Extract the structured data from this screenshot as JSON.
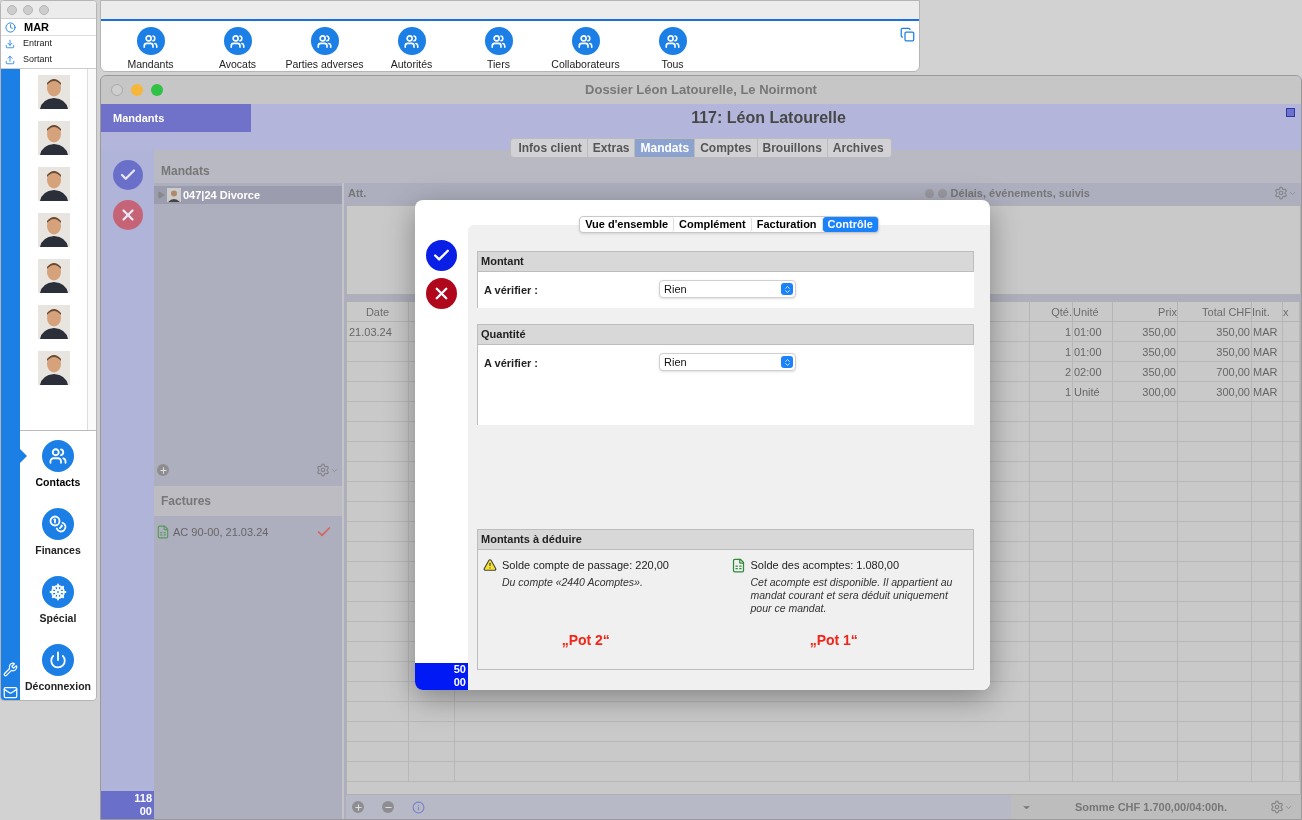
{
  "sidebar_window": {
    "user": "MAR",
    "mail_items": [
      {
        "label": "Entrant",
        "kind": "download"
      },
      {
        "label": "Sortant",
        "kind": "upload"
      }
    ],
    "avatars": [
      {
        "kind": "person"
      },
      {
        "kind": "person"
      },
      {
        "kind": "person"
      },
      {
        "kind": "person"
      },
      {
        "kind": "person"
      },
      {
        "kind": "person"
      },
      {
        "kind": "person"
      }
    ],
    "nav": [
      {
        "label": "Contacts",
        "kind": "contacts",
        "selected": true
      },
      {
        "label": "Finances",
        "kind": "finances",
        "selected": false
      },
      {
        "label": "Spécial",
        "kind": "wheel",
        "selected": false
      },
      {
        "label": "Déconnexion",
        "kind": "power",
        "selected": false
      }
    ]
  },
  "toolbar_window": {
    "buttons": [
      {
        "label": "Mandants"
      },
      {
        "label": "Avocats"
      },
      {
        "label": "Parties adverses"
      },
      {
        "label": "Autorités"
      },
      {
        "label": "Tiers"
      },
      {
        "label": "Collaborateurs"
      },
      {
        "label": "Tous"
      }
    ]
  },
  "main_window": {
    "title": "Dossier Léon Latourelle, Le Noirmont",
    "section": "Mandants",
    "heading": "117: Léon Latourelle",
    "tabs": [
      {
        "label": "Infos client",
        "selected": false
      },
      {
        "label": "Extras",
        "selected": false
      },
      {
        "label": "Mandats",
        "selected": true
      },
      {
        "label": "Comptes",
        "selected": false
      },
      {
        "label": "Brouillons",
        "selected": false
      },
      {
        "label": "Archives",
        "selected": false
      }
    ],
    "counter": [
      "118",
      "00"
    ],
    "mandats": {
      "title": "Mandats",
      "items": [
        {
          "label": "047|24 Divorce",
          "selected": true
        }
      ]
    },
    "factures": {
      "title": "Factures",
      "items": [
        {
          "label": "AC 90-00, 21.03.24",
          "checked": true
        }
      ]
    },
    "att_label": "Att.",
    "events_label": "Délais, événements, suivis",
    "table": {
      "columns_left": [
        "Date"
      ],
      "columns_right": [
        "Qté.",
        "Unité",
        "Prix",
        "Total CHF",
        "Init.",
        "x"
      ],
      "rows": [
        {
          "date": "21.03.24",
          "cells": [
            "1",
            "01:00",
            "350,00",
            "350,00",
            "MAR"
          ]
        },
        {
          "cells": [
            "1",
            "01:00",
            "350,00",
            "350,00",
            "MAR"
          ]
        },
        {
          "cells": [
            "2",
            "02:00",
            "350,00",
            "700,00",
            "MAR"
          ]
        },
        {
          "cells": [
            "1",
            "Unité",
            "300,00",
            "300,00",
            "MAR"
          ]
        }
      ]
    },
    "footer": "Somme CHF 1.700,00/04:00h."
  },
  "dialog": {
    "tabs": [
      {
        "label": "Vue d'ensemble",
        "selected": false
      },
      {
        "label": "Complément",
        "selected": false
      },
      {
        "label": "Facturation",
        "selected": false
      },
      {
        "label": "Contrôle",
        "selected": true
      }
    ],
    "sections": [
      {
        "title": "Montant",
        "label": "A vérifier :",
        "value": "Rien",
        "kind": "short"
      },
      {
        "title": "Quantité",
        "label": "A vérifier :",
        "value": "Rien",
        "kind": "tall"
      }
    ],
    "deductions": {
      "title": "Montants à déduire",
      "items": [
        {
          "kind": "warning",
          "title": "Solde compte de passage: 220,00",
          "note": "Du compte «2440 Acomptes».",
          "tag": "„Pot 2“"
        },
        {
          "kind": "document",
          "title": "Solde des acomptes: 1.080,00",
          "note": "Cet acompte est disponible. Il appartient au mandat courant et sera déduit uniquement pour ce mandat.",
          "tag": "„Pot 1“"
        }
      ]
    },
    "counter": [
      "50",
      "00"
    ]
  }
}
